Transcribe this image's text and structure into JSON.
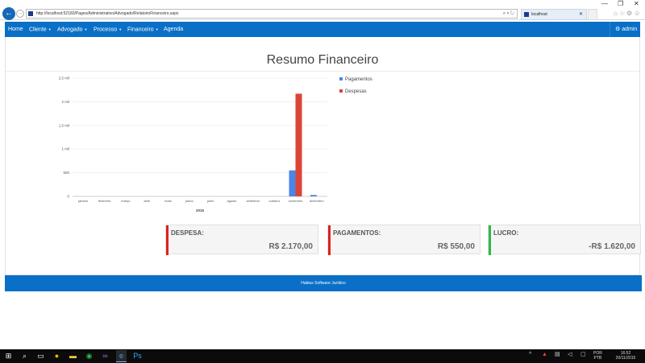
{
  "window": {
    "minimize": "—",
    "restore": "❐",
    "close": "✕"
  },
  "browser": {
    "url": "http://localhost:52183/Pages/Administrativo/Advogado/RelatorioFinanceiro.aspx",
    "tab_title": "localhost",
    "addr_icons": "⌕ ▾ ↻",
    "tool_icons": "⌂☆⚙☺"
  },
  "nav": {
    "items": [
      {
        "label": "Home",
        "caret": false
      },
      {
        "label": "Cliente",
        "caret": true
      },
      {
        "label": "Advogado",
        "caret": true
      },
      {
        "label": "Processo",
        "caret": true
      },
      {
        "label": "Financeiro",
        "caret": true
      },
      {
        "label": "Agenda",
        "caret": false
      }
    ],
    "user": "admin"
  },
  "page": {
    "title": "Resumo Financeiro"
  },
  "chart_data": {
    "type": "bar",
    "xlabel": "2015",
    "categories": [
      "janeiro",
      "fevereiro",
      "março",
      "abril",
      "maio",
      "junho",
      "julho",
      "agosto",
      "setembro",
      "outubro",
      "novembro",
      "dezembro"
    ],
    "series": [
      {
        "name": "Pagamentos",
        "color": "#4a86e8",
        "values": [
          0,
          0,
          0,
          0,
          0,
          0,
          0,
          0,
          0,
          0,
          550,
          30
        ]
      },
      {
        "name": "Despesas",
        "color": "#db4437",
        "values": [
          0,
          0,
          0,
          0,
          0,
          0,
          0,
          0,
          0,
          0,
          2170,
          0
        ]
      }
    ],
    "yticks": [
      {
        "value": 0,
        "label": "0"
      },
      {
        "value": 500,
        "label": "500"
      },
      {
        "value": 1000,
        "label": "1 mil"
      },
      {
        "value": 1500,
        "label": "1,5 mil"
      },
      {
        "value": 2000,
        "label": "2 mil"
      },
      {
        "value": 2500,
        "label": "2,5 mil"
      }
    ],
    "ylim": [
      0,
      2500
    ],
    "legend_position": "right",
    "grid": true
  },
  "cards": [
    {
      "label": "DESPESA:",
      "value": "R$ 2.170,00",
      "color": "#e02020"
    },
    {
      "label": "PAGAMENTOS:",
      "value": "R$ 550,00",
      "color": "#e02020"
    },
    {
      "label": "LUCRO:",
      "value": "-R$ 1.620,00",
      "color": "#2db84b"
    }
  ],
  "footer": {
    "text": "Habius Software Jurídico"
  },
  "taskbar": {
    "lang": "POR",
    "layout": "PTB",
    "time": "16:52",
    "date": "20/11/2015"
  }
}
